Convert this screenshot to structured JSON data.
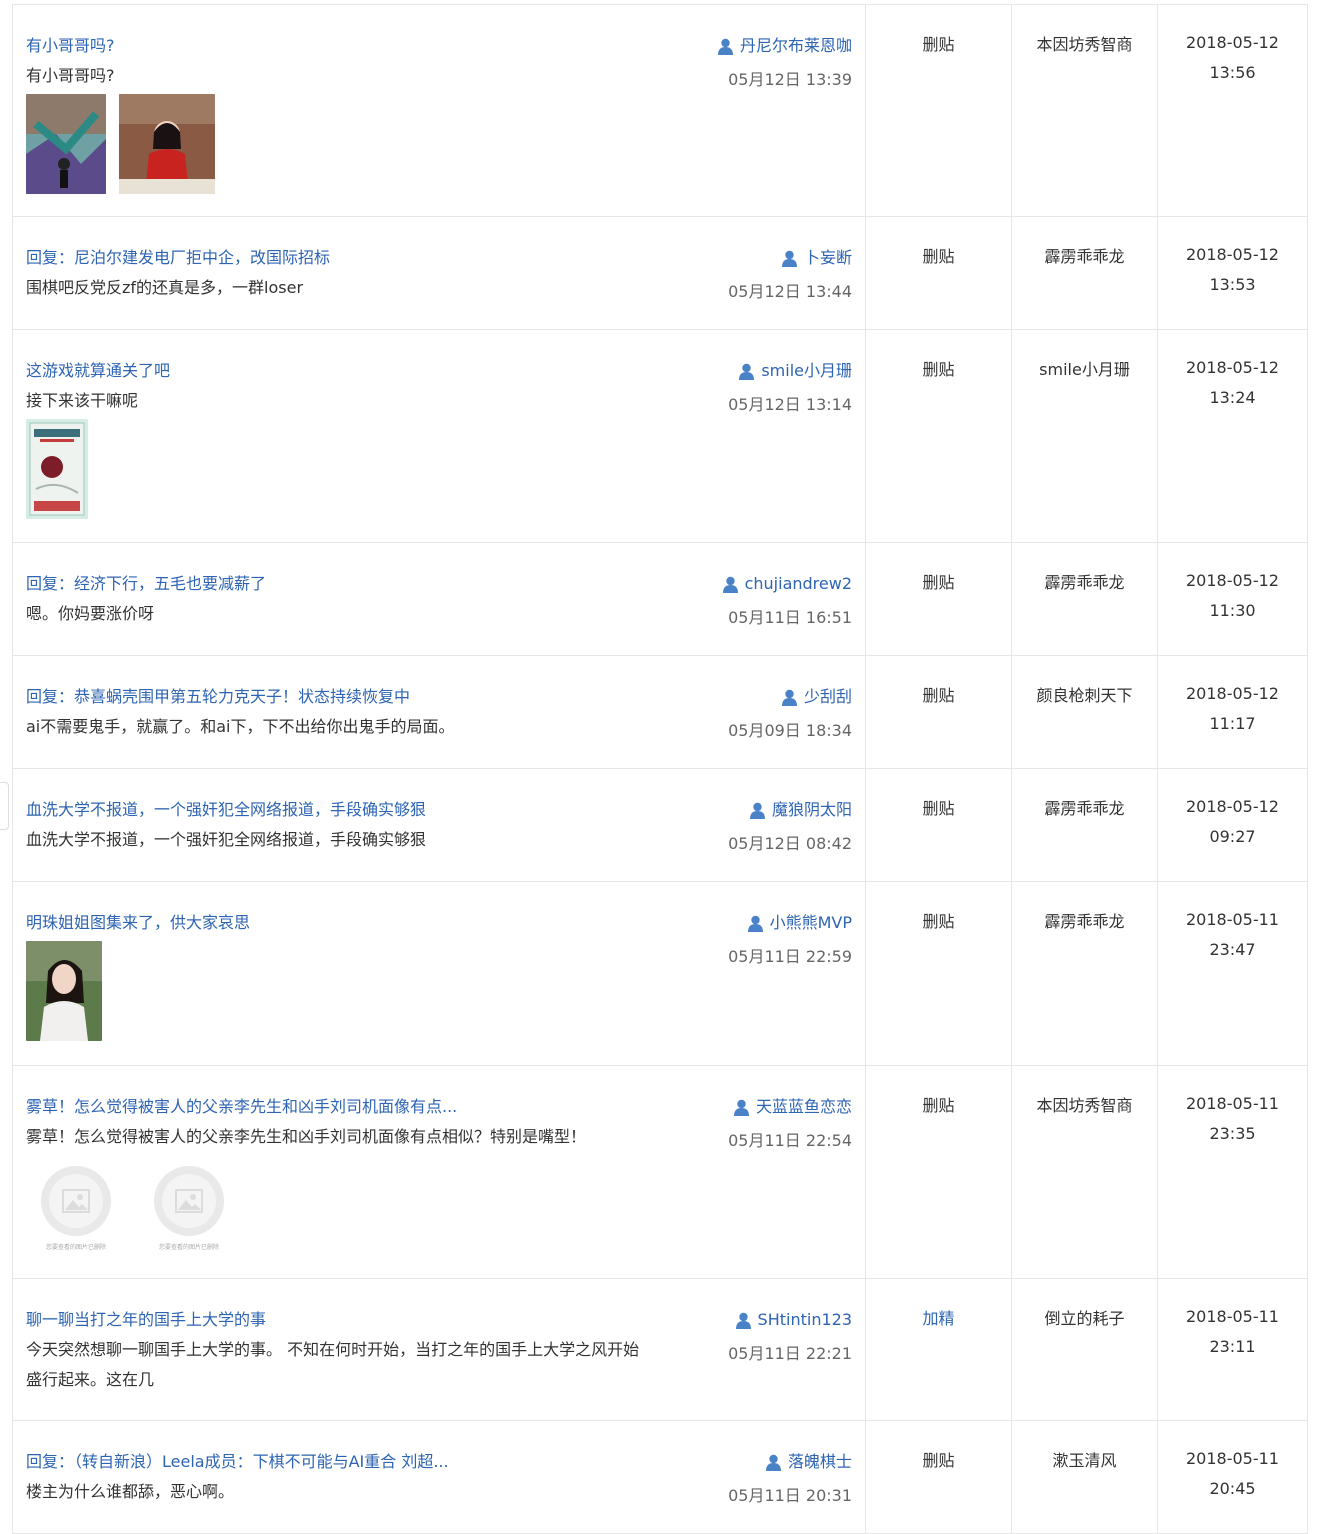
{
  "rows": [
    {
      "title": "有小哥哥吗?",
      "body": "有小哥哥吗?",
      "author": "丹尼尔布莱恩咖",
      "post_time": "05月12日 13:39",
      "action": "删贴",
      "operator": "本因坊秀智商",
      "op_date": "2018-05-12",
      "op_time": "13:56"
    },
    {
      "title": "回复：尼泊尔建发电厂拒中企，改国际招标",
      "body": "围棋吧反党反zf的还真是多，一群loser",
      "author": "卜妄断",
      "post_time": "05月12日 13:44",
      "action": "删贴",
      "operator": "霹雳乖乖龙",
      "op_date": "2018-05-12",
      "op_time": "13:53"
    },
    {
      "title": "这游戏就算通关了吧",
      "body": "接下来该干嘛呢",
      "author": "smile小月珊",
      "post_time": "05月12日 13:14",
      "action": "删贴",
      "operator": "smile小月珊",
      "op_date": "2018-05-12",
      "op_time": "13:24"
    },
    {
      "title": "回复：经济下行，五毛也要减薪了",
      "body": "嗯。你妈要涨价呀",
      "author": "chujiandrew2",
      "post_time": "05月11日 16:51",
      "action": "删贴",
      "operator": "霹雳乖乖龙",
      "op_date": "2018-05-12",
      "op_time": "11:30"
    },
    {
      "title": "回复：恭喜蜗壳围甲第五轮力克天子！状态持续恢复中",
      "body": "ai不需要鬼手，就赢了。和ai下，下不出给你出鬼手的局面。",
      "author": "少刮刮",
      "post_time": "05月09日 18:34",
      "action": "删贴",
      "operator": "颜良枪刺天下",
      "op_date": "2018-05-12",
      "op_time": "11:17"
    },
    {
      "title": "血洗大学不报道，一个强奸犯全网络报道，手段确实够狠",
      "body": "血洗大学不报道，一个强奸犯全网络报道，手段确实够狠",
      "author": "魔狼阴太阳",
      "post_time": "05月12日 08:42",
      "action": "删贴",
      "operator": "霹雳乖乖龙",
      "op_date": "2018-05-12",
      "op_time": "09:27"
    },
    {
      "title": "明珠姐姐图集来了，供大家哀思",
      "body": "",
      "author": "小熊熊MVP",
      "post_time": "05月11日 22:59",
      "action": "删贴",
      "operator": "霹雳乖乖龙",
      "op_date": "2018-05-11",
      "op_time": "23:47"
    },
    {
      "title": "雾草！怎么觉得被害人的父亲李先生和凶手刘司机面像有点...",
      "body": "雾草！怎么觉得被害人的父亲李先生和凶手刘司机面像有点相似？特别是嘴型！",
      "author": "天蓝蓝鱼恋恋",
      "post_time": "05月11日 22:54",
      "action": "删贴",
      "operator": "本因坊秀智商",
      "op_date": "2018-05-11",
      "op_time": "23:35",
      "deleted_caption": "您要查看的图片已删除"
    },
    {
      "title": "聊一聊当打之年的国手上大学的事",
      "body": "今天突然想聊一聊国手上大学的事。 不知在何时开始，当打之年的国手上大学之风开始盛行起来。这在几",
      "author": "SHtintin123",
      "post_time": "05月11日 22:21",
      "action": "加精",
      "operator": "倒立的耗子",
      "op_date": "2018-05-11",
      "op_time": "23:11"
    },
    {
      "title": "回复：（转自新浪）Leela成员：下棋不可能与AI重合 刘超...",
      "body": "楼主为什么谁都舔，恶心啊。",
      "author": "落魄棋士",
      "post_time": "05月11日 20:31",
      "action": "删贴",
      "operator": "漱玉清风",
      "op_date": "2018-05-11",
      "op_time": "20:45"
    }
  ]
}
